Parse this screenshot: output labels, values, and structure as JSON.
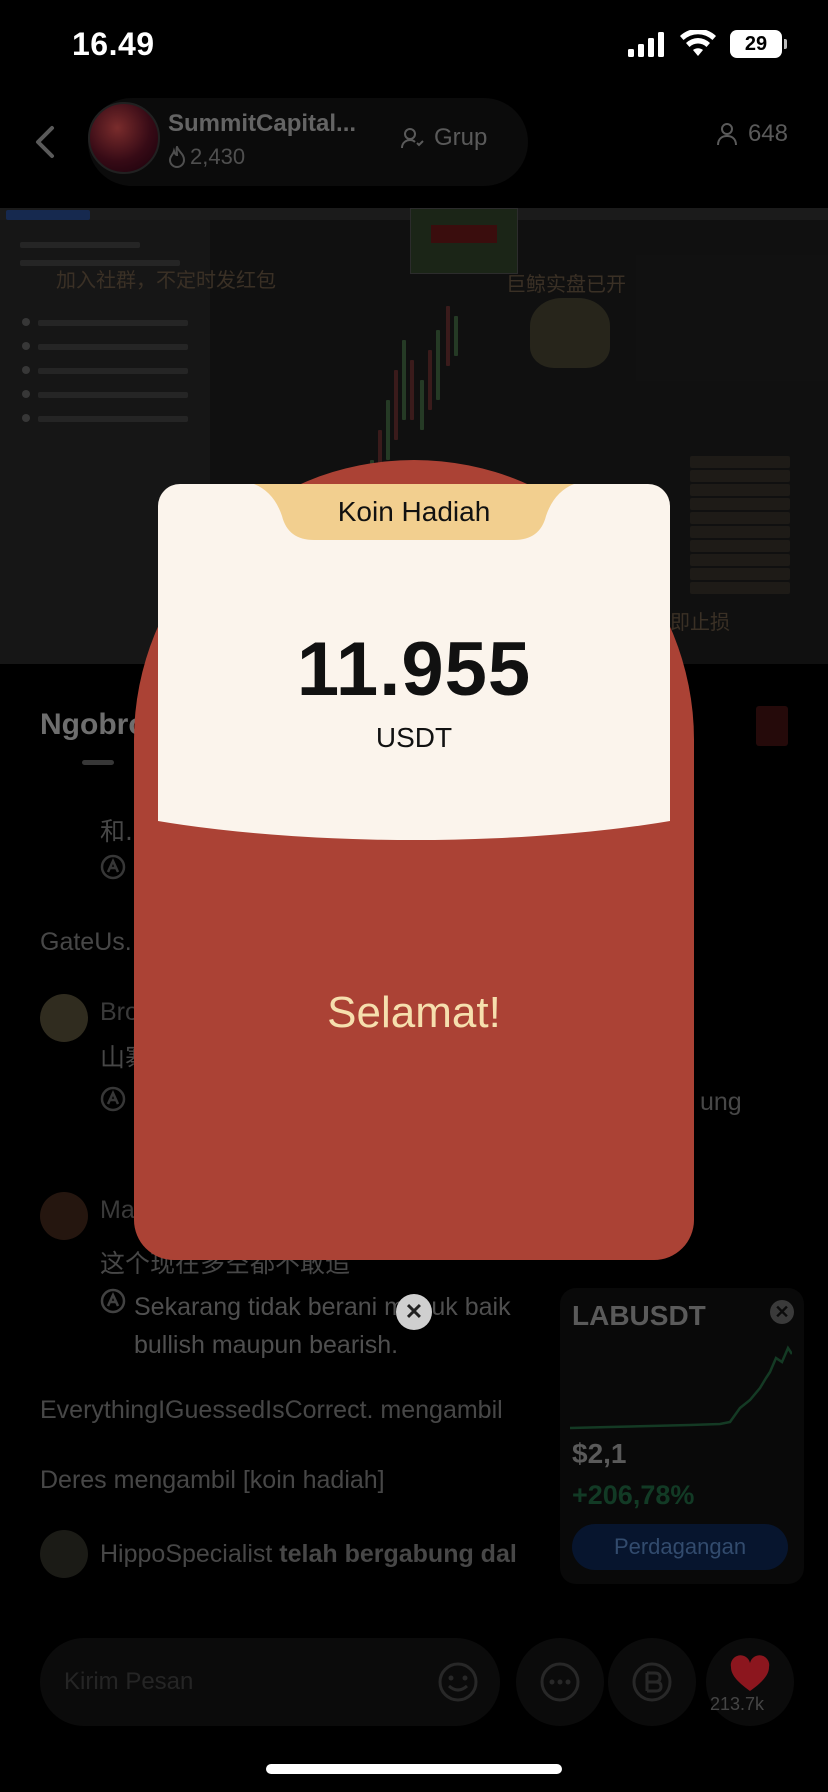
{
  "status_bar": {
    "time": "16.49",
    "battery": "29"
  },
  "header": {
    "group_name": "SummitCapital...",
    "score": "2,430",
    "group_button": "Grup",
    "member_count": "648"
  },
  "pinned_image": {
    "text_left": "加入社群，不定时发红包",
    "text_right": "巨鲸实盘已开",
    "text_bottom": "即止损"
  },
  "chat": {
    "tab_title": "Ngobro",
    "messages": [
      {
        "line": "和..."
      },
      {
        "line": "GateUs..."
      },
      {
        "user": "Bro...",
        "line": "山寨..."
      },
      {
        "translation_end": "ung"
      },
      {
        "user": "Ma...",
        "line": "这个现在多空都不敢追"
      },
      {
        "translation": "Sekarang tidak berani masuk baik bullish maupun bearish."
      }
    ],
    "system_1": "EverythingIGuessedIsCorrect. mengambil",
    "system_2": "Deres mengambil [koin hadiah]",
    "join_user": "HippoSpecialist",
    "join_text": "telah bergabung dal"
  },
  "ticker": {
    "symbol": "LABUSDT",
    "price": "$2,1",
    "change": "+206,78%",
    "trade_button": "Perdagangan"
  },
  "input": {
    "placeholder": "Kirim Pesan"
  },
  "like_count": "213.7k",
  "modal": {
    "title": "Koin Hadiah",
    "amount": "11.955",
    "currency": "USDT",
    "congrats": "Selamat!"
  },
  "colors": {
    "packet_red": "#ab4235",
    "card_cream": "#fbf4ec",
    "tab_gold": "#f2cf8f",
    "congrats_text": "#f6dfae",
    "heart": "#d8232f"
  }
}
